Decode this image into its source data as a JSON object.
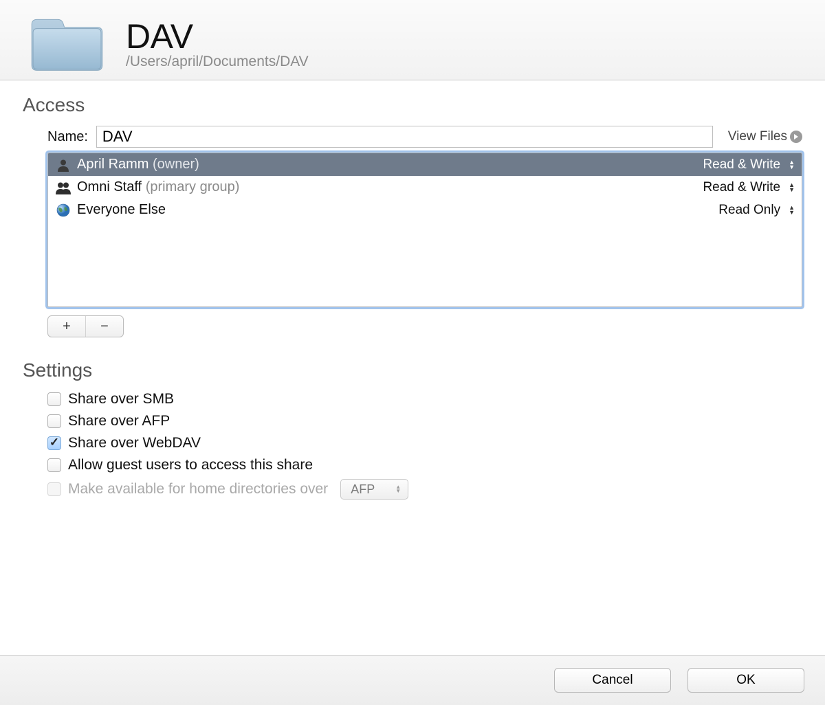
{
  "header": {
    "title": "DAV",
    "path": "/Users/april/Documents/DAV"
  },
  "access": {
    "section_title": "Access",
    "name_label": "Name:",
    "name_value": "DAV",
    "view_files_label": "View Files",
    "rows": [
      {
        "name": "April Ramm",
        "suffix": "(owner)",
        "permission": "Read & Write",
        "selected": true
      },
      {
        "name": "Omni Staff",
        "suffix": "(primary group)",
        "permission": "Read & Write",
        "selected": false
      },
      {
        "name": "Everyone Else",
        "suffix": "",
        "permission": "Read Only",
        "selected": false
      }
    ]
  },
  "settings": {
    "section_title": "Settings",
    "items": {
      "smb": {
        "label": "Share over SMB",
        "checked": false,
        "disabled": false
      },
      "afp": {
        "label": "Share over AFP",
        "checked": false,
        "disabled": false
      },
      "webdav": {
        "label": "Share over WebDAV",
        "checked": true,
        "disabled": false
      },
      "guest": {
        "label": "Allow guest users to access this share",
        "checked": false,
        "disabled": false
      },
      "home": {
        "label": "Make available for home directories over",
        "checked": false,
        "disabled": true,
        "protocol": "AFP"
      }
    }
  },
  "footer": {
    "cancel_label": "Cancel",
    "ok_label": "OK"
  }
}
